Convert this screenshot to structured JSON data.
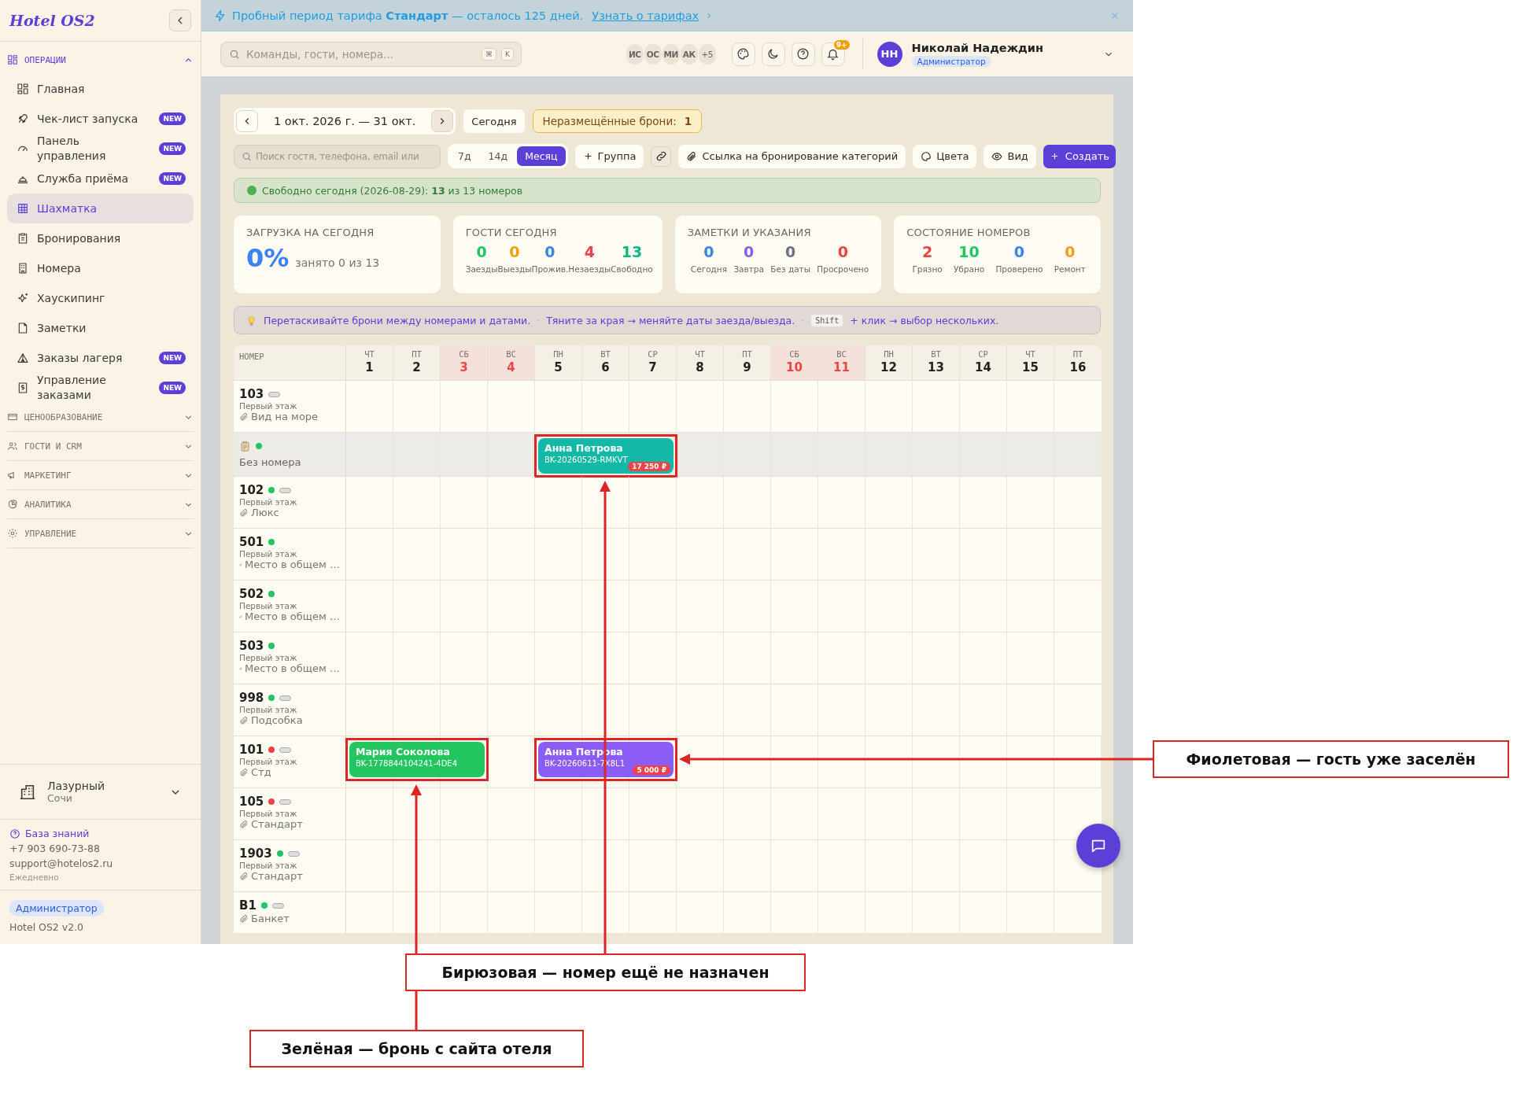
{
  "sidebar": {
    "logo": "Hotel OS2",
    "sections": [
      {
        "label": "ОПЕРАЦИИ",
        "expanded": true,
        "items": [
          {
            "label": "Главная",
            "selected": false
          },
          {
            "label": "Чек-лист запуска",
            "badge": "NEW",
            "selected": false
          },
          {
            "label": "Панель управления",
            "badge": "NEW",
            "selected": false
          },
          {
            "label": "Служба приёма",
            "badge": "NEW",
            "selected": false
          },
          {
            "label": "Шахматка",
            "selected": true
          },
          {
            "label": "Бронирования",
            "selected": false
          },
          {
            "label": "Номера",
            "selected": false
          },
          {
            "label": "Хаускипинг",
            "selected": false
          },
          {
            "label": "Заметки",
            "selected": false
          },
          {
            "label": "Заказы лагеря",
            "badge": "NEW",
            "selected": false
          },
          {
            "label": "Управление заказами",
            "badge": "NEW",
            "selected": false
          }
        ]
      },
      {
        "label": "ЦЕНООБРАЗОВАНИЕ",
        "expanded": false
      },
      {
        "label": "ГОСТИ И CRM",
        "expanded": false
      },
      {
        "label": "МАРКЕТИНГ",
        "expanded": false
      },
      {
        "label": "АНАЛИТИКА",
        "expanded": false
      },
      {
        "label": "УПРАВЛЕНИЕ",
        "expanded": false
      }
    ],
    "property": {
      "name": "Лазурный",
      "city": "Сочи"
    },
    "help": {
      "link": "База знаний",
      "phone": "+7 903 690-73-88",
      "email": "support@hotelos2.ru",
      "hours": "Ежедневно"
    },
    "footer": {
      "role": "Администратор",
      "version": "Hotel OS2 v2.0"
    }
  },
  "banner": {
    "text": "Пробный период тарифа **Стандарт** — осталось 125 дней.",
    "link": "Узнать о тарифах"
  },
  "topbar": {
    "search_placeholder": "Команды, гости, номера...",
    "shortcut": [
      "⌘",
      "K"
    ],
    "presence": [
      "ИС",
      "ОС",
      "МИ",
      "АК"
    ],
    "presence_more": "+5",
    "notifications": "9+",
    "user": {
      "initials": "НН",
      "name": "Николай Надеждин",
      "role": "Администратор"
    }
  },
  "toolbar": {
    "date_range": "1 окт. 2026 г. — 31 окт.",
    "today_button": "Сегодня",
    "unplaced": {
      "label": "Неразмещённые брони:",
      "count": "1"
    },
    "search_placeholder": "Поиск гостя, телефона, email или",
    "views": [
      {
        "label": "7д",
        "selected": false
      },
      {
        "label": "14д",
        "selected": false
      },
      {
        "label": "Месяц",
        "selected": true
      }
    ],
    "group_button": "Группа",
    "category_link_button": "Ссылка на бронирование категорий",
    "colors_button": "Цвета",
    "view_button": "Вид",
    "create_button": "Создать"
  },
  "availability": "Свободно сегодня (2026-08-29): **13** из 13 номеров",
  "stats": [
    {
      "kind": "occupancy",
      "title": "ЗАГРУЗКА НА СЕГОДНЯ",
      "value": "0%",
      "caption": "занято 0 из 13"
    },
    {
      "kind": "metrics",
      "title": "ГОСТИ СЕГОДНЯ",
      "metrics": [
        {
          "value": "0",
          "label": "Заезды",
          "color": "#22c55e"
        },
        {
          "value": "0",
          "label": "Выезды",
          "color": "#f59e0b"
        },
        {
          "value": "0",
          "label": "Прожив.",
          "color": "#3b82f6"
        },
        {
          "value": "4",
          "label": "Незаезды",
          "color": "#ef4444"
        },
        {
          "value": "13",
          "label": "Свободно",
          "color": "#10b981"
        }
      ]
    },
    {
      "kind": "metrics",
      "title": "ЗАМЕТКИ И УКАЗАНИЯ",
      "metrics": [
        {
          "value": "0",
          "label": "Сегодня",
          "color": "#3b82f6"
        },
        {
          "value": "0",
          "label": "Завтра",
          "color": "#8b5cf6"
        },
        {
          "value": "0",
          "label": "Без даты",
          "color": "#6b7280"
        },
        {
          "value": "0",
          "label": "Просрочено",
          "color": "#ef4444"
        }
      ]
    },
    {
      "kind": "metrics",
      "title": "СОСТОЯНИЕ НОМЕРОВ",
      "metrics": [
        {
          "value": "2",
          "label": "Грязно",
          "color": "#ef4444"
        },
        {
          "value": "10",
          "label": "Убрано",
          "color": "#22c55e"
        },
        {
          "value": "0",
          "label": "Проверено",
          "color": "#3b82f6"
        },
        {
          "value": "0",
          "label": "Ремонт",
          "color": "#f59e0b"
        }
      ]
    }
  ],
  "hints": {
    "items": [
      "Перетаскивайте брони между номерами и датами.",
      "Тяните за края → меняйте даты заезда/выезда."
    ],
    "separator": "·",
    "key": "Shift",
    "key_text": "+ клик → выбор нескольких."
  },
  "grid": {
    "room_header": "НОМЕР",
    "days": [
      {
        "weekday": "ЧТ",
        "day": "1",
        "weekend": false
      },
      {
        "weekday": "ПТ",
        "day": "2",
        "weekend": false
      },
      {
        "weekday": "СБ",
        "day": "3",
        "weekend": true
      },
      {
        "weekday": "ВС",
        "day": "4",
        "weekend": true
      },
      {
        "weekday": "ПН",
        "day": "5",
        "weekend": false
      },
      {
        "weekday": "ВТ",
        "day": "6",
        "weekend": false
      },
      {
        "weekday": "СР",
        "day": "7",
        "weekend": false
      },
      {
        "weekday": "ЧТ",
        "day": "8",
        "weekend": false
      },
      {
        "weekday": "ПТ",
        "day": "9",
        "weekend": false
      },
      {
        "weekday": "СБ",
        "day": "10",
        "weekend": true
      },
      {
        "weekday": "ВС",
        "day": "11",
        "weekend": true
      },
      {
        "weekday": "ПН",
        "day": "12",
        "weekend": false
      },
      {
        "weekday": "ВТ",
        "day": "13",
        "weekend": false
      },
      {
        "weekday": "СР",
        "day": "14",
        "weekend": false
      },
      {
        "weekday": "ЧТ",
        "day": "15",
        "weekend": false
      },
      {
        "weekday": "ПТ",
        "day": "16",
        "weekend": false
      }
    ],
    "rooms": [
      {
        "kind": "room",
        "number": "103",
        "pill": true,
        "floor": "Первый этаж",
        "category": "Вид на море"
      },
      {
        "kind": "unassigned",
        "color": "#22c55e",
        "label": "Без номера",
        "timeline": [
          {
            "kind": "free"
          },
          {
            "kind": "free"
          },
          {
            "kind": "free"
          },
          {
            "kind": "free"
          },
          {
            "kind": "booking",
            "guest": "Анна Петрова",
            "code": "BK-20260529-RMKVT",
            "price": "17 250 ₽",
            "color": "#14b8a6",
            "annotated": true
          },
          {
            "kind": "continued"
          },
          {
            "kind": "continued"
          }
        ]
      },
      {
        "kind": "room",
        "number": "102",
        "color": "#22c55e",
        "pill": true,
        "floor": "Первый этаж",
        "category": "Люкс"
      },
      {
        "kind": "room",
        "number": "501",
        "color": "#22c55e",
        "pill": false,
        "floor": "Первый этаж",
        "category": "Место в общем …"
      },
      {
        "kind": "room",
        "number": "502",
        "color": "#22c55e",
        "pill": false,
        "floor": "Первый этаж",
        "category": "Место в общем …"
      },
      {
        "kind": "room",
        "number": "503",
        "color": "#22c55e",
        "pill": false,
        "floor": "Первый этаж",
        "category": "Место в общем …"
      },
      {
        "kind": "room",
        "number": "998",
        "color": "#22c55e",
        "pill": true,
        "floor": "Первый этаж",
        "category": "Подсобка"
      },
      {
        "kind": "room",
        "number": "101",
        "color": "#ef4444",
        "pill": true,
        "floor": "Первый этаж",
        "category": "Стд",
        "timeline": [
          {
            "kind": "booking",
            "guest": "Мария Соколова",
            "code": "BK-1778844104241-4DE4",
            "color": "#22c55e",
            "annotated": true
          },
          {
            "kind": "continued"
          },
          {
            "kind": "continued"
          },
          {
            "kind": "free"
          },
          {
            "kind": "booking",
            "guest": "Анна Петрова",
            "code": "BK-20260611-7X8L1",
            "price": "5 000 ₽",
            "color": "#8b5cf6",
            "annotated": true
          },
          {
            "kind": "continued"
          },
          {
            "kind": "continued"
          }
        ]
      },
      {
        "kind": "room",
        "number": "105",
        "color": "#ef4444",
        "pill": true,
        "floor": "Первый этаж",
        "category": "Стандарт"
      },
      {
        "kind": "room",
        "number": "1903",
        "color": "#22c55e",
        "pill": true,
        "floor": "Первый этаж",
        "category": "Стандарт"
      },
      {
        "kind": "room",
        "number": "B1",
        "color": "#22c55e",
        "pill": true,
        "category": "Банкет"
      }
    ]
  },
  "annotations": [
    {
      "text": "Фиолетовая — гость уже заселён"
    },
    {
      "text": "Бирюзовая — номер ещё не назначен"
    },
    {
      "text": "Зелёная — бронь с сайта отеля"
    }
  ]
}
